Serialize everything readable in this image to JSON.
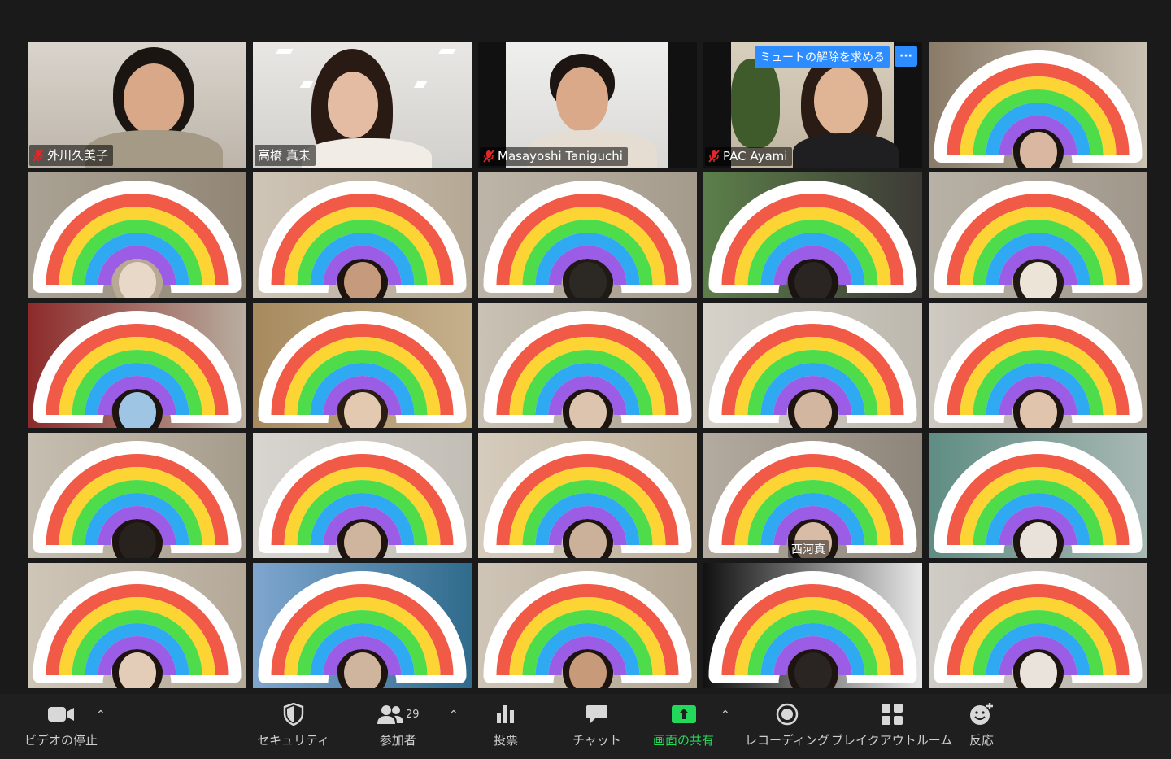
{
  "participants_top": [
    {
      "name": "外川久美子",
      "muted": true
    },
    {
      "name": "高橋 真未",
      "muted": false,
      "active": true
    },
    {
      "name": "Masayoshi Taniguchi",
      "muted": true
    },
    {
      "name": "PAC Ayami",
      "muted": true,
      "unmute_request": "ミュートの解除を求める",
      "more": "···"
    }
  ],
  "hidden_label": "西河真",
  "rainbow_colors": [
    "#f05a47",
    "#fcd534",
    "#4fdc4a",
    "#2fa9f2",
    "#9b5ce6"
  ],
  "toolbar": {
    "video_stop": "ビデオの停止",
    "security": "セキュリティ",
    "participants": "参加者",
    "participant_count": "29",
    "polls": "投票",
    "chat": "チャット",
    "share_screen": "画面の共有",
    "recording": "レコーディング",
    "breakout_rooms": "ブレイクアウトルーム",
    "reactions": "反応"
  },
  "colors": {
    "share_green": "#23d959",
    "active_border": "#d4e157",
    "unmute_blue": "#2d8cff"
  }
}
